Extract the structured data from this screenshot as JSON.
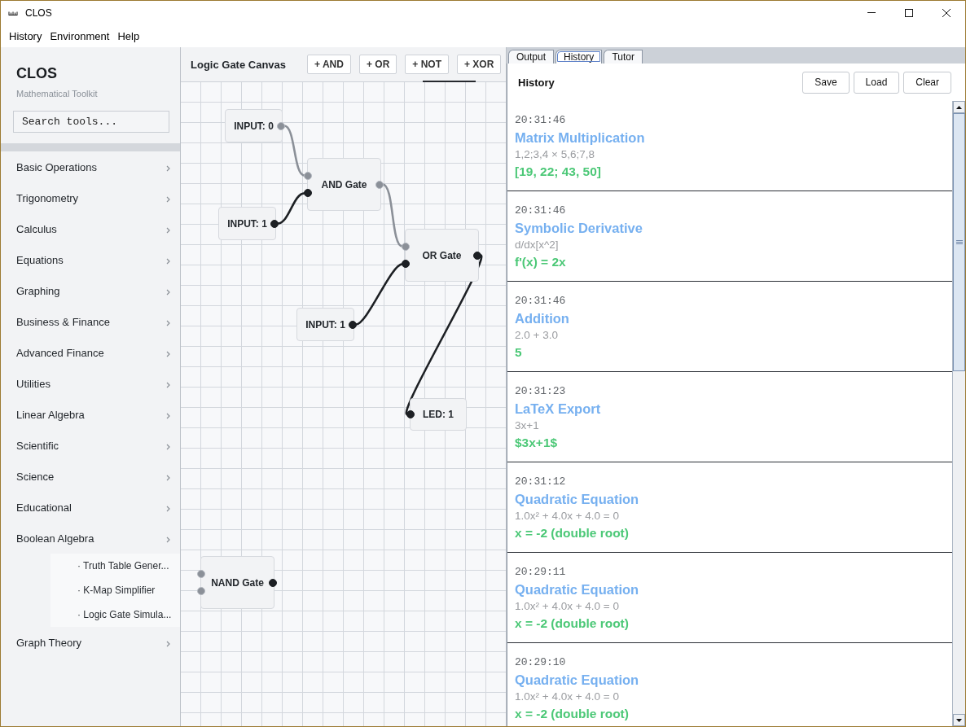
{
  "window": {
    "title": "CLOS"
  },
  "menu": [
    "History",
    "Environment",
    "Help"
  ],
  "sidebar": {
    "title": "CLOS",
    "subtitle": "Mathematical Toolkit",
    "search": {
      "placeholder": "Search tools..."
    },
    "items": [
      {
        "label": "Basic Operations"
      },
      {
        "label": "Trigonometry"
      },
      {
        "label": "Calculus"
      },
      {
        "label": "Equations"
      },
      {
        "label": "Graphing"
      },
      {
        "label": "Business & Finance"
      },
      {
        "label": "Advanced Finance"
      },
      {
        "label": "Utilities"
      },
      {
        "label": "Linear Algebra"
      },
      {
        "label": "Scientific"
      },
      {
        "label": "Science"
      },
      {
        "label": "Educational"
      },
      {
        "label": "Boolean Algebra",
        "expanded": true,
        "children": [
          {
            "label": "· Truth Table Gener..."
          },
          {
            "label": "· K-Map Simplifier"
          },
          {
            "label": "· Logic Gate Simula..."
          }
        ]
      },
      {
        "label": "Graph Theory"
      }
    ]
  },
  "canvas": {
    "title": "Logic Gate Canvas",
    "buttons": [
      "+ AND",
      "+ OR",
      "+ NOT",
      "+ XOR"
    ],
    "nodes": [
      {
        "kind": "input",
        "label": "INPUT: 0",
        "output": {
          "active": false
        }
      },
      {
        "kind": "gate",
        "label": "AND Gate",
        "inputs": [
          {
            "active": false
          },
          {
            "active": true
          }
        ],
        "output": {
          "active": false
        }
      },
      {
        "kind": "input",
        "label": "INPUT: 1",
        "output": {
          "active": true
        }
      },
      {
        "kind": "gate",
        "label": "OR Gate",
        "inputs": [
          {
            "active": false
          },
          {
            "active": true
          }
        ],
        "output": {
          "active": true
        }
      },
      {
        "kind": "input",
        "label": "INPUT: 1",
        "output": {
          "active": true
        }
      },
      {
        "kind": "led",
        "label": "LED: 1",
        "inputs": [
          {
            "active": true
          }
        ]
      },
      {
        "kind": "gate",
        "label": "NAND Gate",
        "inputs": [
          {
            "active": false
          },
          {
            "active": false
          }
        ],
        "output": {
          "active": true
        }
      }
    ]
  },
  "result_panel": {
    "tabs": [
      {
        "label": "Output",
        "selected": false
      },
      {
        "label": "History",
        "selected": true
      },
      {
        "label": "Tutor",
        "selected": false
      }
    ],
    "title": "History",
    "buttons": [
      "Save",
      "Load",
      "Clear"
    ],
    "entries": [
      {
        "time": "20:31:46",
        "operation": "Matrix Multiplication",
        "input": "1,2;3,4 × 5,6;7,8",
        "result": "[19, 22; 43, 50]"
      },
      {
        "time": "20:31:46",
        "operation": "Symbolic Derivative",
        "input": "d/dx[x^2]",
        "result": "f'(x) = 2x"
      },
      {
        "time": "20:31:46",
        "operation": "Addition",
        "input": "2.0 + 3.0",
        "result": "5"
      },
      {
        "time": "20:31:23",
        "operation": "LaTeX Export",
        "input": "3x+1",
        "result": "$3x+1$"
      },
      {
        "time": "20:31:12",
        "operation": "Quadratic Equation",
        "input": "1.0x² + 4.0x + 4.0 = 0",
        "result": "x = -2 (double root)"
      },
      {
        "time": "20:29:11",
        "operation": "Quadratic Equation",
        "input": "1.0x² + 4.0x + 4.0 = 0",
        "result": "x = -2 (double root)"
      },
      {
        "time": "20:29:10",
        "operation": "Quadratic Equation",
        "input": "1.0x² + 4.0x + 4.0 = 0",
        "result": "x = -2 (double root)"
      }
    ]
  }
}
